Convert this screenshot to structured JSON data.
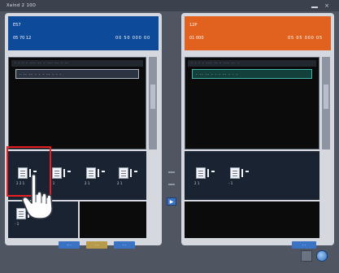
{
  "window": {
    "title": "Xalnd 2 10D"
  },
  "left_panel": {
    "header": {
      "line1": "E57",
      "line2": "05 70 12",
      "line3": "00 50 000 00"
    },
    "toolbar": "- -  - -  ---  -- -  ---  -- - --",
    "strip": "- -- -- -  - -  -- -  - -",
    "thumbnails": [
      {
        "label": "2 2 1"
      },
      {
        "label": "- 1"
      },
      {
        "label": "2 1"
      },
      {
        "label": "2 1"
      },
      {
        "label": "- 1"
      }
    ],
    "buttons": [
      {
        "label": "-- -"
      },
      {
        "label": "- -"
      },
      {
        "label": "- -"
      }
    ],
    "corner_text": "- - -"
  },
  "right_panel": {
    "header": {
      "line1": "12P",
      "line2": "01 000",
      "line3": "05 05 000 05"
    },
    "toolbar": "- -  - -  ---  -- -  ---  -- -",
    "strip": "- -- -- -  - -  -- -  - -",
    "thumbnails": [
      {
        "label": "2 1"
      },
      {
        "label": "- 1"
      }
    ],
    "buttons": [
      {
        "label": "- -"
      }
    ],
    "corner_text": "- - -"
  },
  "middle": {
    "transfer_arrow": "▶"
  },
  "icons": {
    "thumbnail": "document-image-icon",
    "pointer": "pointing-hand-icon",
    "transfer": "arrow-right-icon",
    "settings": "settings-icon",
    "globe": "globe-icon"
  },
  "colors": {
    "left_header": "#0d4a9a",
    "right_header": "#e1621e",
    "highlight": "#e81e23",
    "button_blue": "#3a73c4",
    "button_gold": "#b89a4b"
  }
}
